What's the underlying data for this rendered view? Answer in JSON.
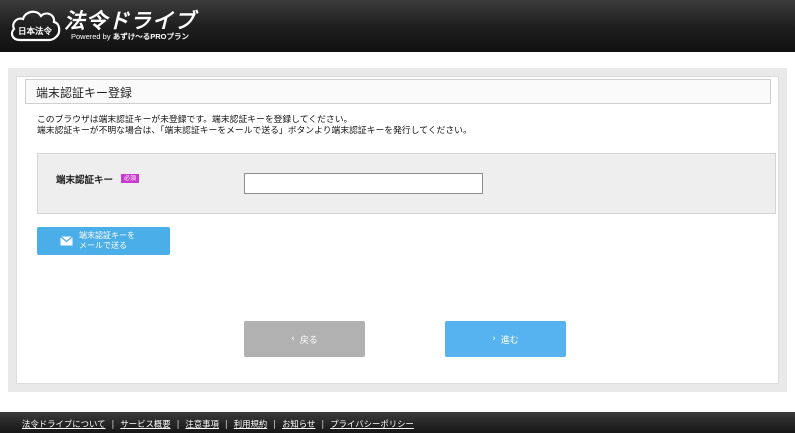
{
  "header": {
    "logo_badge": "日本法令",
    "logo_title": "法令ドライブ",
    "logo_sub_prefix": "Powered by ",
    "logo_sub_brand": "あずけ〜るPROプラン"
  },
  "main": {
    "title": "端末認証キー登録",
    "notice_line1": "このブラウザは端末認証キーが未登録です。端末認証キーを登録してください。",
    "notice_line2": "端末認証キーが不明な場合は、「端末認証キーをメールで送る」ボタンより端末認証キーを発行してください。",
    "field_label": "端末認証キー",
    "required_badge": "必須",
    "key_input": {
      "value": "",
      "placeholder": ""
    },
    "mail_button_line1": "端末認証キーを",
    "mail_button_line2": "メールで送る",
    "back_button": "戻る",
    "next_button": "進む",
    "colors": {
      "primary": "#57b3ef",
      "mail_button": "#4aaee8",
      "disabled": "#b1b1b1",
      "badge": "#c83bd0"
    }
  },
  "footer": {
    "links": [
      "法令ドライブについて",
      "サービス概要",
      "注意事項",
      "利用規約",
      "お知らせ",
      "プライバシーポリシー"
    ]
  }
}
